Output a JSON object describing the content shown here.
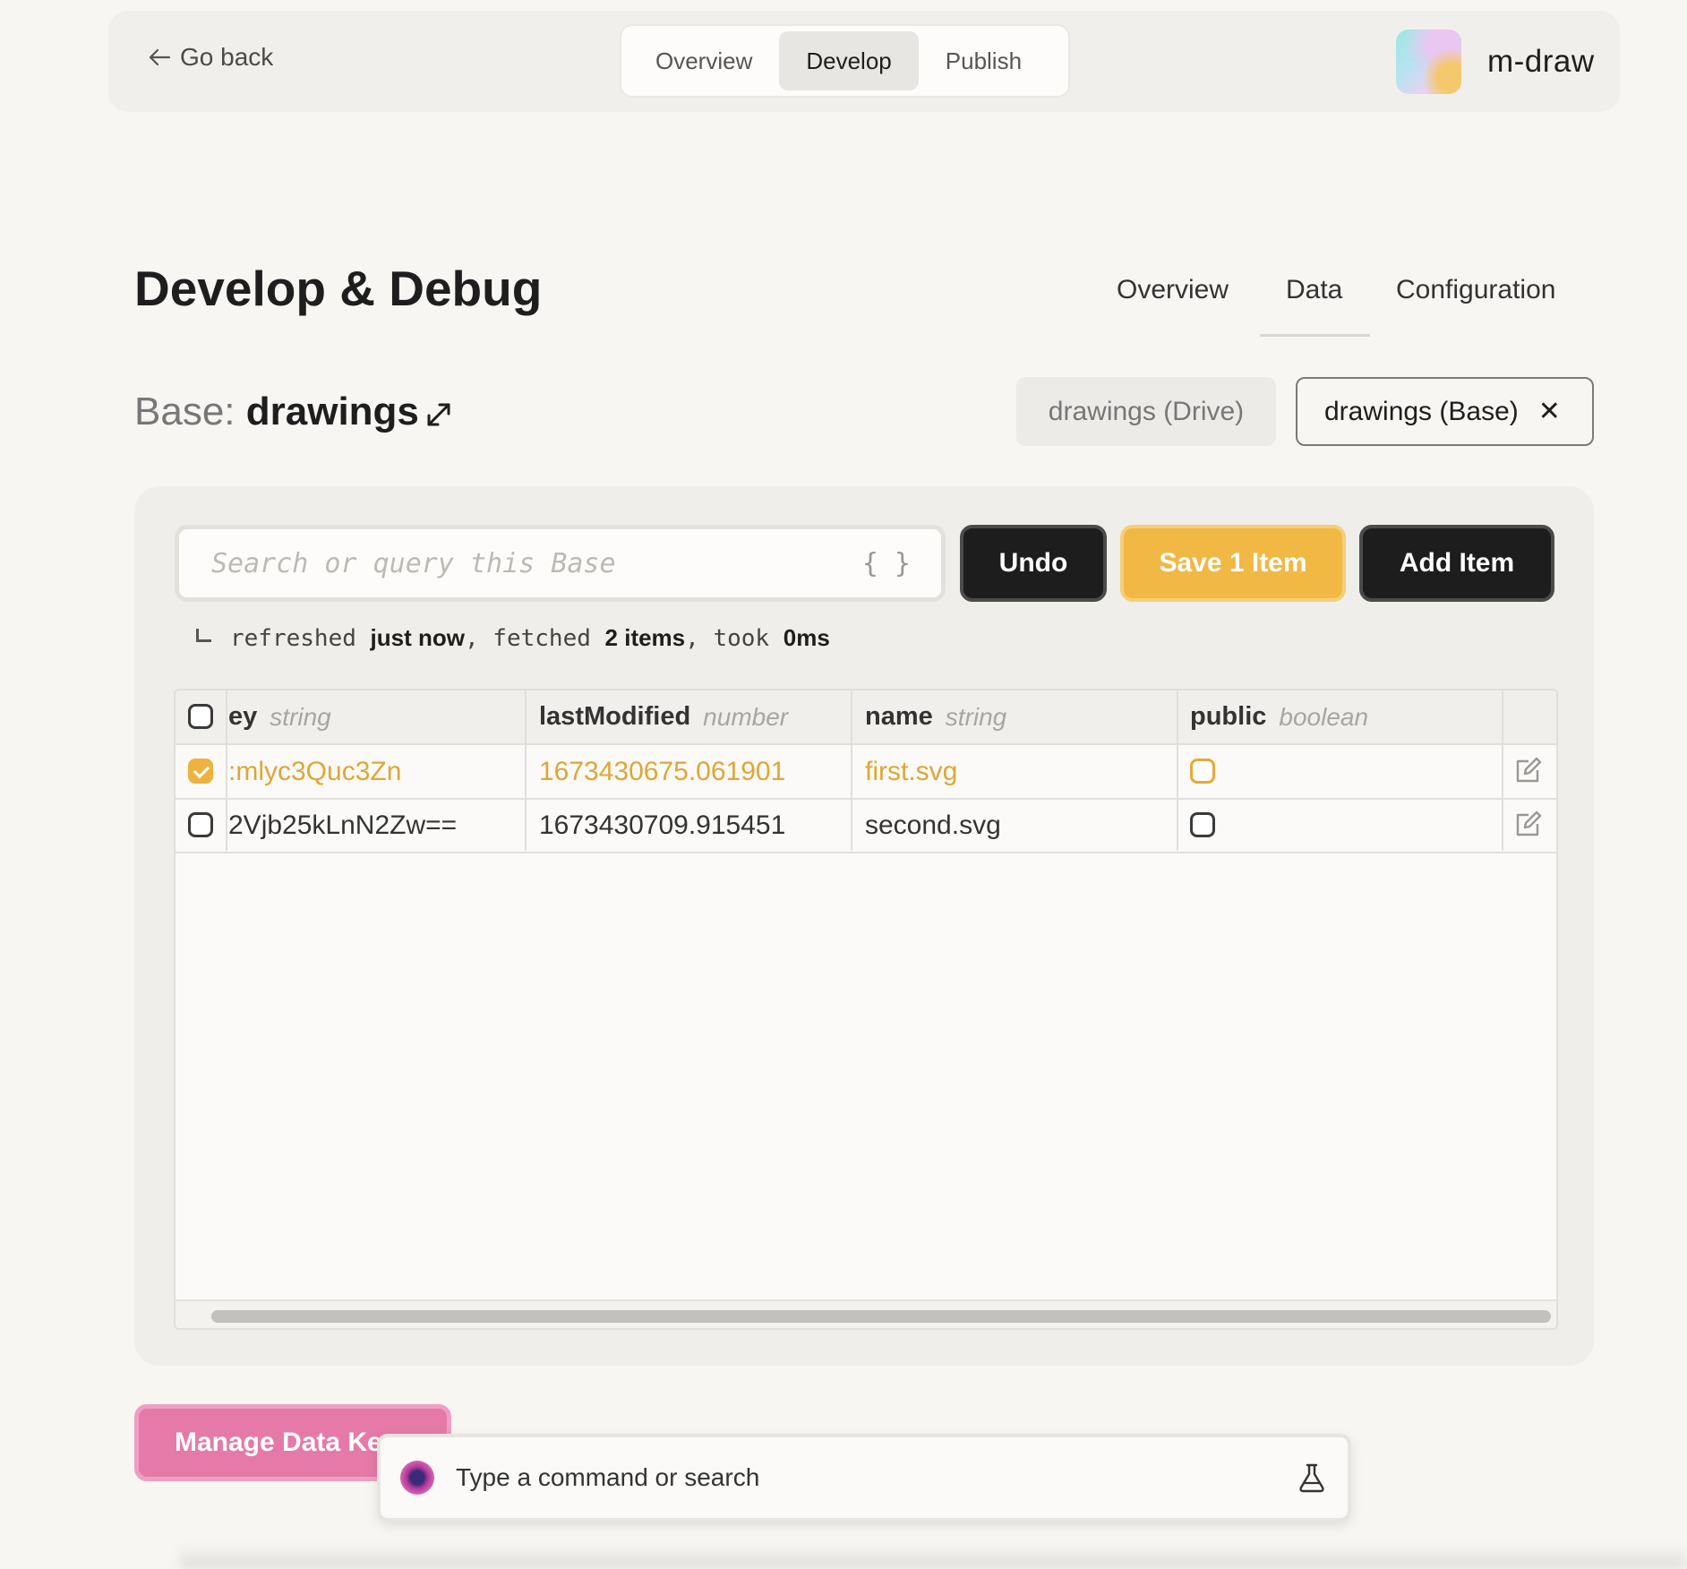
{
  "header": {
    "back_label": "Go back",
    "tabs": [
      {
        "label": "Overview",
        "active": false
      },
      {
        "label": "Develop",
        "active": true
      },
      {
        "label": "Publish",
        "active": false
      }
    ],
    "app_name": "m-draw"
  },
  "page": {
    "title": "Develop & Debug",
    "sub_tabs": [
      {
        "label": "Overview",
        "active": false
      },
      {
        "label": "Data",
        "active": true
      },
      {
        "label": "Configuration",
        "active": false
      }
    ]
  },
  "base": {
    "prefix": "Base:",
    "name": "drawings",
    "chips": [
      {
        "label": "drawings (Drive)",
        "active": false
      },
      {
        "label": "drawings (Base)",
        "active": true,
        "close_symbol": "✕"
      }
    ]
  },
  "search": {
    "placeholder": "Search or query this Base",
    "query_icon": "{ }"
  },
  "actions": {
    "undo": "Undo",
    "save": "Save 1 Item",
    "add": "Add Item"
  },
  "status": {
    "refreshed_label": "refreshed",
    "refreshed_value": "just now",
    "fetched_label": "fetched",
    "fetched_value": "2 items",
    "took_label": "took",
    "took_value": "0ms",
    "comma": ","
  },
  "table": {
    "columns": [
      {
        "name": "ey",
        "type": "string"
      },
      {
        "name": "lastModified",
        "type": "number"
      },
      {
        "name": "name",
        "type": "string"
      },
      {
        "name": "public",
        "type": "boolean"
      }
    ],
    "rows": [
      {
        "selected": true,
        "key": ":mlyc3Quc3Zn",
        "lastModified": "1673430675.061901",
        "name": "first.svg",
        "public": false
      },
      {
        "selected": false,
        "key": "2Vjb25kLnN2Zw==",
        "lastModified": "1673430709.915451",
        "name": "second.svg",
        "public": false
      }
    ]
  },
  "manage_button": "Manage Data Keys",
  "command_bar": {
    "placeholder": "Type a command or search"
  },
  "colors": {
    "accent_yellow": "#f1b844",
    "accent_pink": "#e57aa8",
    "dark_button": "#1d1d1d",
    "background": "#f7f6f3"
  },
  "icons": {
    "back": "arrow-left-icon",
    "expand": "expand-diagonal-icon",
    "close": "close-icon",
    "edit": "edit-icon",
    "flask": "flask-icon",
    "orb": "assistant-orb-icon"
  }
}
